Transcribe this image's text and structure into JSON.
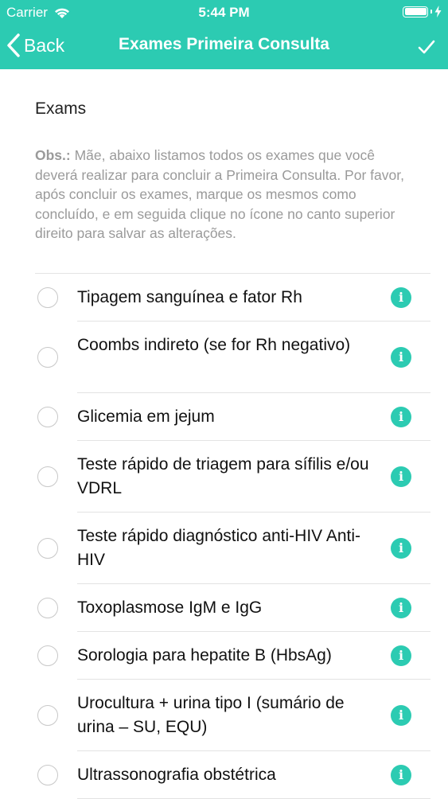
{
  "status_bar": {
    "carrier": "Carrier",
    "time": "5:44 PM"
  },
  "nav": {
    "back_label": "Back",
    "title": "Exames Primeira Consulta"
  },
  "section": {
    "title": "Exams",
    "obs_label": "Obs.:",
    "obs_text": " Mãe, abaixo listamos todos os exames que você deverá realizar para concluir a Primeira Consulta. Por favor, após concluir os exames, marque os mesmos como concluído, e em seguida clique no ícone no canto superior direito para salvar as alterações."
  },
  "exams": [
    {
      "label": "Tipagem sanguínea e fator Rh",
      "checked": false
    },
    {
      "label": "Coombs indireto (se for Rh negativo)",
      "checked": false
    },
    {
      "label": "Glicemia em jejum",
      "checked": false
    },
    {
      "label": "Teste rápido de triagem para sífilis e/ou VDRL",
      "checked": false
    },
    {
      "label": "Teste rápido diagnóstico anti-HIV Anti-HIV",
      "checked": false
    },
    {
      "label": "Toxoplasmose IgM e IgG",
      "checked": false
    },
    {
      "label": "Sorologia para hepatite B (HbsAg)",
      "checked": false
    },
    {
      "label": "Urocultura + urina tipo I (sumário de urina – SU, EQU)",
      "checked": false
    },
    {
      "label": "Ultrassonografia obstétrica",
      "checked": false
    }
  ],
  "info_glyph": "i",
  "icons": {
    "wifi": "wifi-icon",
    "battery": "battery-icon",
    "charging": "charging-bolt-icon",
    "back": "chevron-left-icon",
    "save": "checkmark-icon",
    "info": "info-icon",
    "radio": "radio-unchecked-icon"
  },
  "colors": {
    "accent": "#2ccbb2",
    "text": "#111111",
    "muted": "#9a9a9a",
    "divider": "#e3e3e3"
  }
}
